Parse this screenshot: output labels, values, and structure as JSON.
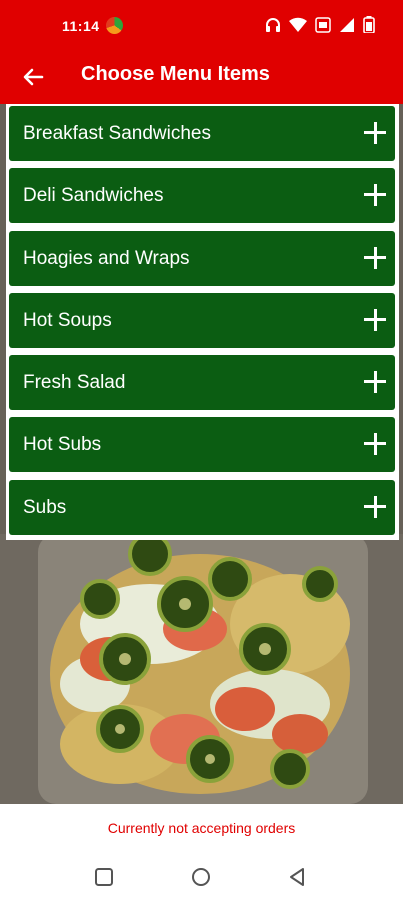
{
  "status_bar": {
    "time": "11:14",
    "icons": [
      "app-logo-icon",
      "headphones-icon",
      "wifi-icon",
      "volte-icon",
      "signal-icon",
      "battery-icon"
    ]
  },
  "app_bar": {
    "title": "Choose Menu Items",
    "back_icon": "arrow-left-icon"
  },
  "menu": {
    "items": [
      {
        "label": "Breakfast Sandwiches",
        "icon": "plus-icon"
      },
      {
        "label": "Deli Sandwiches",
        "icon": "plus-icon"
      },
      {
        "label": "Hoagies and Wraps",
        "icon": "plus-icon"
      },
      {
        "label": "Hot Soups",
        "icon": "plus-icon"
      },
      {
        "label": "Fresh Salad",
        "icon": "plus-icon"
      },
      {
        "label": "Hot Subs",
        "icon": "plus-icon"
      },
      {
        "label": "Subs",
        "icon": "plus-icon"
      }
    ]
  },
  "footer": {
    "message": "Currently not accepting orders"
  },
  "nav_bar": {
    "buttons": [
      "recents-icon",
      "home-icon",
      "back-icon"
    ]
  },
  "colors": {
    "brand_red": "#e00000",
    "menu_green": "#0b5d12",
    "footer_text": "#e00000"
  }
}
